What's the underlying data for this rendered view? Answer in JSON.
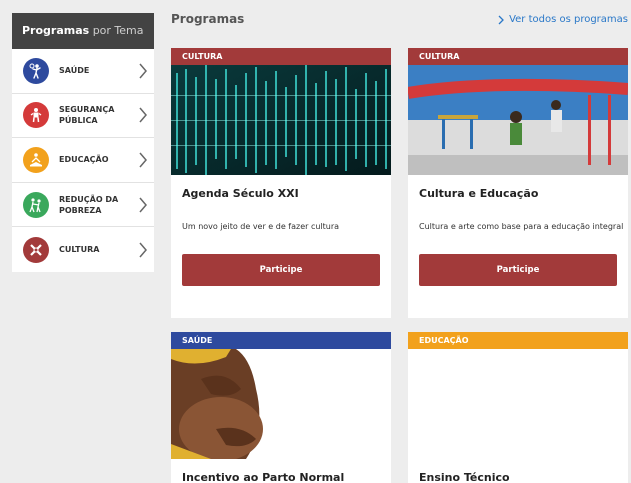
{
  "sidebar": {
    "header_bold": "Programas",
    "header_light": "por Tema",
    "items": [
      {
        "label": "SAÚDE",
        "icon": "health-icon",
        "color": "#2e4a9e"
      },
      {
        "label": "SEGURANÇA PÚBLICA",
        "icon": "security-icon",
        "color": "#d43a3a"
      },
      {
        "label": "EDUCAÇÃO",
        "icon": "education-icon",
        "color": "#f2a11c"
      },
      {
        "label": "REDUÇÃO DA POBREZA",
        "icon": "poverty-reduction-icon",
        "color": "#3aa85c"
      },
      {
        "label": "CULTURA",
        "icon": "culture-icon",
        "color": "#a23a3a"
      }
    ]
  },
  "main": {
    "title": "Programas",
    "see_all": "Ver todos os programas"
  },
  "cards": [
    {
      "category": "CULTURA",
      "category_color": "#a23a3a",
      "title": "Agenda Século XXI",
      "description": "Um novo jeito de ver e de fazer cultura",
      "button": "Participe"
    },
    {
      "category": "CULTURA",
      "category_color": "#a23a3a",
      "title": "Cultura e Educação",
      "description": "Cultura e arte como base para a educação integral",
      "button": "Participe"
    },
    {
      "category": "SAÚDE",
      "category_color": "#2e4a9e",
      "title": "Incentivo ao Parto Normal"
    },
    {
      "category": "EDUCAÇÃO",
      "category_color": "#f2a11c",
      "title": "Ensino Técnico"
    }
  ]
}
